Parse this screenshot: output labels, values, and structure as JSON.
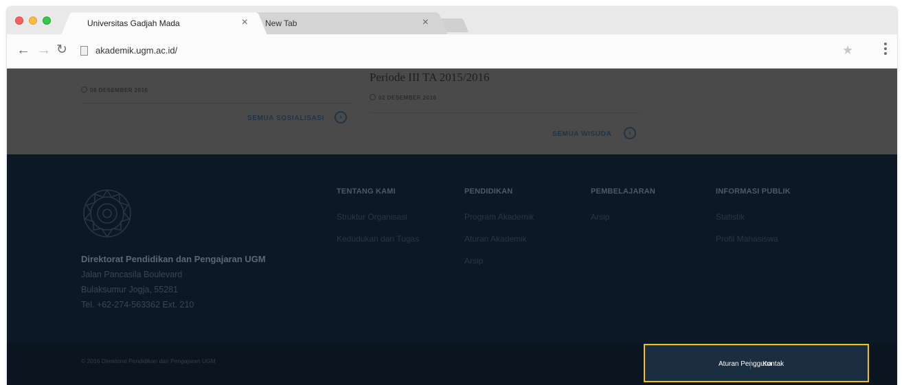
{
  "browser": {
    "tabs": [
      {
        "title": "Universitas Gadjah Mada",
        "close": "×"
      },
      {
        "title": "New Tab",
        "close": "×"
      }
    ],
    "url": "akademik.ugm.ac.id/"
  },
  "news": {
    "left": {
      "date": "08 DESEMBER 2016",
      "more": "SEMUA SOSIALISASI"
    },
    "right": {
      "title": "Periode III TA 2015/2016",
      "date": "02 DESEMBER 2016",
      "more": "SEMUA WISUDA"
    }
  },
  "footer": {
    "org_name": "Direktorat Pendidikan dan Pengajaran UGM",
    "address": [
      "Jalan Pancasila Boulevard",
      "Bulaksumur Jogja, 55281",
      "Tel. +62-274-563362 Ext. 210"
    ],
    "columns": [
      {
        "heading": "TENTANG KAMI",
        "links": [
          "Struktur Organisasi",
          "Kedudukan dan Tugas"
        ]
      },
      {
        "heading": "PENDIDIKAN",
        "links": [
          "Program Akademik",
          "Aturan Akademik",
          "Arsip"
        ]
      },
      {
        "heading": "PEMBELAJARAN",
        "links": [
          "Arsip"
        ]
      },
      {
        "heading": "INFORMASI PUBLIK",
        "links": [
          "Statistik",
          "Profil Mahasiswa"
        ]
      }
    ],
    "copyright": "© 2016 Direktorat Pendidikan dan Pengajaran UGM",
    "bottom_links": [
      "Aturan Pengguna",
      "Kontak"
    ]
  },
  "colors": {
    "highlight_border": "#f2c500",
    "footer_bg": "#0c1824"
  }
}
